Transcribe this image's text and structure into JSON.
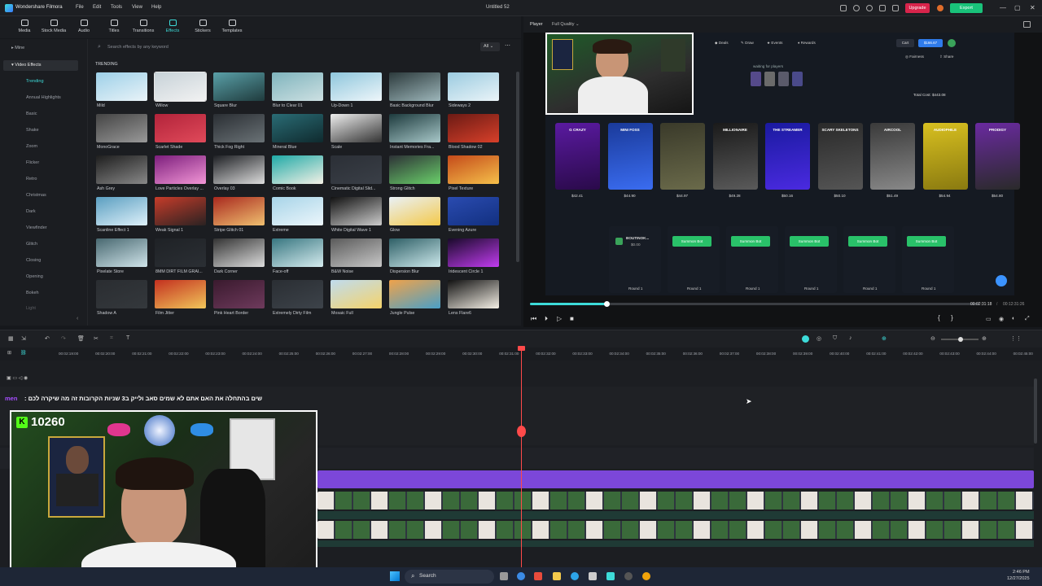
{
  "app": {
    "name": "Wondershare Filmora",
    "document": "Untitled 52",
    "upgrade": "Upgrade",
    "export": "Export"
  },
  "menu": [
    "File",
    "Edit",
    "Tools",
    "View",
    "Help"
  ],
  "tabs": [
    {
      "label": "Media",
      "active": false
    },
    {
      "label": "Stock Media",
      "active": false
    },
    {
      "label": "Audio",
      "active": false
    },
    {
      "label": "Titles",
      "active": false
    },
    {
      "label": "Transitions",
      "active": false
    },
    {
      "label": "Effects",
      "active": true
    },
    {
      "label": "Stickers",
      "active": false
    },
    {
      "label": "Templates",
      "active": false
    }
  ],
  "sidebar": {
    "mine": "Mine",
    "section": "Video Effects",
    "items": [
      "Trending",
      "Annual Highlights",
      "Basic",
      "Shake",
      "Zoom",
      "Flicker",
      "Retro",
      "Christmas",
      "Dark",
      "Viewfinder",
      "Glitch",
      "Closing",
      "Opening",
      "Bokeh",
      "Light"
    ]
  },
  "effects": {
    "search_placeholder": "Search effects by any keyword",
    "filter": "All",
    "category": "TRENDING",
    "items": [
      "Mild",
      "Willow",
      "Square Blur",
      "Blur to Clear 01",
      "Up-Down 1",
      "Basic Background Blur",
      "Sideways 2",
      "MonoGrace",
      "Scarlet Shade",
      "Thick Fog Right",
      "Mineral Blue",
      "Scale",
      "Instant Memories Fra...",
      "Blood Shadow 02",
      "Ash Grey",
      "Love Particles Overlay ...",
      "Overlay 03",
      "Comic Book",
      "Cinematic Digital Slid...",
      "Strong Glitch",
      "Pixel Texture",
      "Scanline Effect 1",
      "Weak Signal 1",
      "Stripe Glitch 01",
      "Extreme",
      "White Digital Wave 1",
      "Glow",
      "Evening Azure",
      "Pixelate Store",
      "8MM DIRT FILM GRAI...",
      "Dark Corner",
      "Face-off",
      "B&W Noise",
      "Dispersion Blur",
      "Iridescent Circle 1",
      "Shadow A",
      "Film Jitter",
      "Pink Heart Border",
      "Extremely Dirty Film",
      "Mosaic Full",
      "Jungle Pulse",
      "Lens Flare6"
    ]
  },
  "player": {
    "label": "Player",
    "quality": "Full Quality",
    "current_time": "00:02:31:18",
    "total_time": "00:12:31:26",
    "progress": 0.17
  },
  "video": {
    "nav": [
      "Deals",
      "Draw",
      "Events",
      "Rewards"
    ],
    "cart": "Cart",
    "cart_price": "$166.67",
    "fairness": "Fairness",
    "share": "Share",
    "waiting": "waiting for players",
    "total": "Total Cost: $443.08",
    "cases": [
      {
        "name": "G CRAZY",
        "price": "$42.41"
      },
      {
        "name": "MINI FOSS",
        "price": "$44.90"
      },
      {
        "name": "",
        "price": "$44.97"
      },
      {
        "name": "MILLIONAIRE",
        "price": "$49.28"
      },
      {
        "name": "THE STREAMER",
        "price": "$50.16"
      },
      {
        "name": "SCARY SKELETONS",
        "price": "$50.10"
      },
      {
        "name": "AIRCOOL",
        "price": "$51.49"
      },
      {
        "name": "AUDIOPHILE",
        "price": "$54.94"
      },
      {
        "name": "PRODIGY",
        "price": "$54.80"
      }
    ],
    "player1": "BOUTINOK...",
    "player1_amount": "$0.00",
    "summon": "Summon Bot",
    "round": "Round 1"
  },
  "timeline": {
    "ruler": [
      "00:02:19:00",
      "00:02:20:00",
      "00:02:21:00",
      "00:02:22:00",
      "00:02:23:00",
      "00:02:24:00",
      "00:02:25:00",
      "00:02:26:00",
      "00:02:27:00",
      "00:02:28:00",
      "00:02:29:00",
      "00:02:30:00",
      "00:02:31:00",
      "00:02:32:00",
      "00:02:33:00",
      "00:02:34:00",
      "00:02:35:00",
      "00:02:36:00",
      "00:02:37:00",
      "00:02:38:00",
      "00:02:39:00",
      "00:02:40:00",
      "00:02:41:00",
      "00:02:42:00",
      "00:02:43:00",
      "00:02:44:00",
      "00:02:45:00"
    ]
  },
  "chat": {
    "user": "men",
    "message": "שים בהתחלה את האם אתם לא שמים סאב ולייק ב3 שניות הקרובות זה מה שיקרה לכם :"
  },
  "webcam": {
    "counter": "10260"
  },
  "taskbar": {
    "search": "Search",
    "time": "2:46 PM",
    "date": "12/27/2025"
  }
}
